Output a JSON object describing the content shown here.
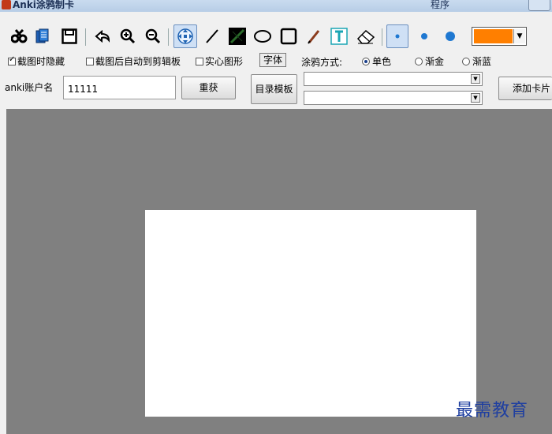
{
  "titlebar": {
    "app_title": "Anki涂鸦制卡",
    "right_text": "程序"
  },
  "toolbar": {
    "tools": [
      {
        "name": "cut-icon"
      },
      {
        "name": "copy-icon"
      },
      {
        "name": "save-icon"
      },
      {
        "name": "undo-icon"
      },
      {
        "name": "zoom-in-icon"
      },
      {
        "name": "zoom-out-icon"
      },
      {
        "name": "move-icon",
        "pressed": true
      },
      {
        "name": "line-icon"
      },
      {
        "name": "fill-icon"
      },
      {
        "name": "ellipse-icon"
      },
      {
        "name": "rectangle-icon"
      },
      {
        "name": "pen-icon"
      },
      {
        "name": "text-icon"
      },
      {
        "name": "eraser-icon"
      },
      {
        "name": "brush-size-small-icon",
        "pressed": true
      },
      {
        "name": "brush-size-medium-icon"
      },
      {
        "name": "brush-size-large-icon"
      }
    ],
    "current_color": "#ff7f00"
  },
  "options": {
    "hide_on_capture": {
      "label": "截图时隐藏",
      "checked": true
    },
    "copy_after_capture": {
      "label": "截图后自动到剪辑板",
      "checked": false
    },
    "solid_shape": {
      "label": "实心图形",
      "checked": false
    },
    "font_button": "字体",
    "paint_mode_label": "涂鸦方式:",
    "paint_modes": [
      {
        "label": "单色",
        "selected": true
      },
      {
        "label": "渐金",
        "selected": false
      },
      {
        "label": "渐蓝",
        "selected": false
      }
    ]
  },
  "account": {
    "label": "anki账户名",
    "value": "11111",
    "reload_button": "重获",
    "template_button": "目录模板",
    "deck_select": "",
    "model_select": "",
    "add_card_button": "添加卡片"
  },
  "canvas": {
    "background": "#808080",
    "page_color": "#ffffff"
  },
  "watermark": "最需教育"
}
